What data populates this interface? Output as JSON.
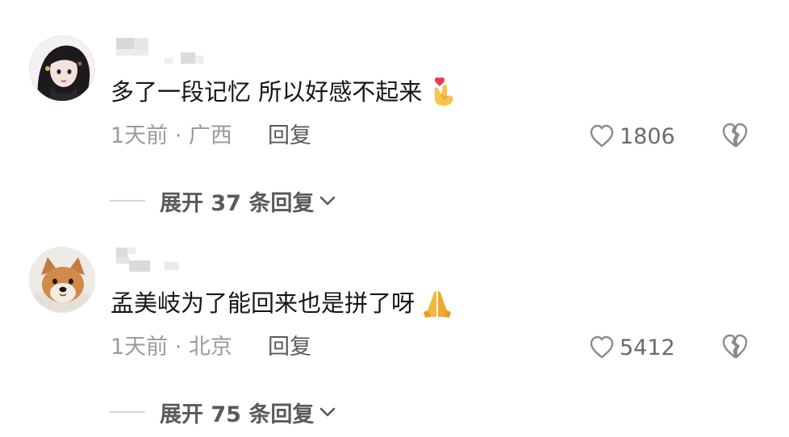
{
  "comments": [
    {
      "text": "多了一段记忆 所以好感不起来",
      "emoji_name": "finger-heart-emoji",
      "meta": "1天前 · 广西",
      "reply_label": "回复",
      "likes": "1806",
      "expand_label": "展开 37 条回复"
    },
    {
      "text": "孟美岐为了能回来也是拼了呀",
      "emoji_name": "folded-hands-emoji",
      "meta": "1天前 · 北京",
      "reply_label": "回复",
      "likes": "5412",
      "expand_label": "展开 75 条回复"
    }
  ],
  "colors": {
    "text": "#161616",
    "meta": "#9b9b9b",
    "action": "#5a5a5a",
    "divider": "#d6d6d6",
    "icon": "#8a8a8a"
  }
}
